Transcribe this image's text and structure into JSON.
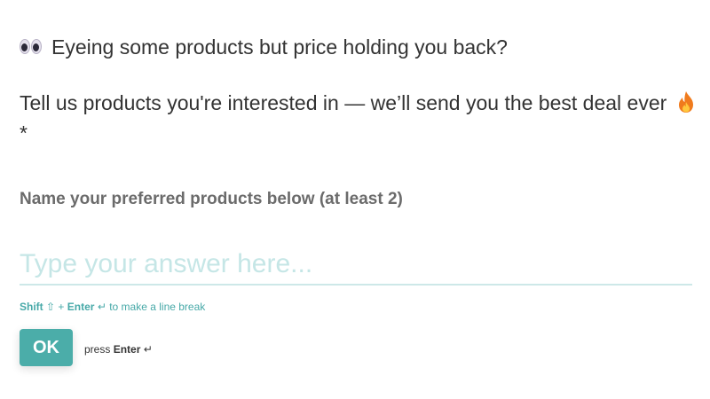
{
  "intro": {
    "emoji_icon": "eyes-emoji-icon",
    "text": "Eyeing some products but price holding you back?"
  },
  "question": {
    "text": "Tell us products you're interested in — we’ll send you the best deal ever",
    "emoji_icon": "fire-emoji-icon",
    "required_mark": "*"
  },
  "description": "Name your preferred products below (at least 2)",
  "answer": {
    "placeholder": "Type your answer here...",
    "value": ""
  },
  "hint": {
    "shift_label": "Shift",
    "shift_symbol": "⇧",
    "plus": "+",
    "enter_label": "Enter",
    "enter_symbol": "↵",
    "suffix": "to make a line break"
  },
  "ok_button": {
    "label": "OK"
  },
  "press_enter": {
    "prefix": "press",
    "key_label": "Enter",
    "key_symbol": "↵"
  },
  "colors": {
    "accent": "#4bada9",
    "hint_text": "#47a9a8",
    "placeholder": "#c5e6e6",
    "underline": "#cde8e8",
    "body_text": "#333333",
    "description_text": "#6b6b6b"
  }
}
